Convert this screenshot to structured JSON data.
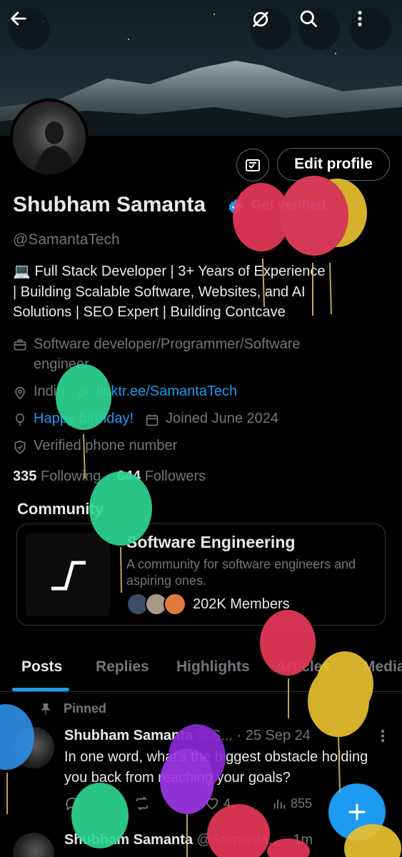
{
  "header": {
    "back_icon": "arrow-left-icon",
    "actions": [
      "satellite-off-icon",
      "search-icon",
      "more-vertical-icon"
    ]
  },
  "profile": {
    "name": "Shubham Samanta",
    "get_verified": "Get verified",
    "handle": "@SamantaTech",
    "edit_profile": "Edit profile",
    "bio_lines": [
      "💻 Full Stack Developer | 3+ Years of Experience",
      "| Building Scalable Software, Websites, and AI",
      "Solutions | SEO Expert | Building Contcave"
    ],
    "category": "Software developer/Programmer/Software engineer",
    "location": "India",
    "website": "linktr.ee/SamantaTech",
    "birthday": "Happy birthday!",
    "joined": "Joined June 2024",
    "verified_phone": "Verified phone number",
    "following_count": "335",
    "following_label": "Following",
    "followers_count": "644",
    "followers_label": "Followers"
  },
  "community": {
    "section_title": "Community",
    "name": "Software Engineering",
    "description": "A community for software engineers and aspiring ones.",
    "members": "202K Members"
  },
  "tabs": [
    "Posts",
    "Replies",
    "Highlights",
    "Articles",
    "Media"
  ],
  "posts": [
    {
      "pinned_label": "Pinned",
      "author": "Shubham Samanta",
      "handle": "@S...",
      "date": "· 25 Sep 24",
      "text": "In one word, what's the biggest obstacle holding you back from reaching your goals?",
      "likes": "4",
      "views": "855"
    },
    {
      "author": "Shubham Samanta",
      "handle": "@Samanta...",
      "date": "· 1m"
    }
  ],
  "colors": {
    "accent": "#1d9bf0",
    "muted": "#71767b",
    "text": "#e7e9ea",
    "border": "#2f3336"
  }
}
